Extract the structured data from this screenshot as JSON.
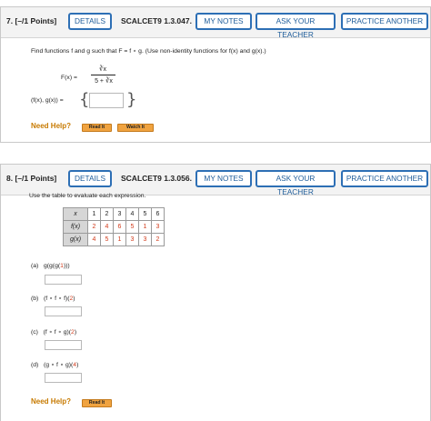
{
  "q7": {
    "number": "7.  [–/1 Points]",
    "details": "DETAILS",
    "code": "SCALCET9 1.3.047.",
    "my_notes": "MY NOTES",
    "ask_teacher": "ASK YOUR TEACHER",
    "practice": "PRACTICE ANOTHER",
    "prompt": "Find functions f and g such that F = f ∘ g. (Use non-identity functions for f(x) and g(x).)",
    "fx_label": "F(x)  =",
    "numerator": "∛x",
    "denominator": "5 + ∛x",
    "pair_label": "(f(x), g(x))  =",
    "open_brace": "{",
    "close_brace": "}",
    "answer_value": "",
    "need_help": "Need Help?",
    "read_it": "Read It",
    "watch_it": "Watch It"
  },
  "q8": {
    "number": "8.  [–/1 Points]",
    "details": "DETAILS",
    "code": "SCALCET9 1.3.056.",
    "my_notes": "MY NOTES",
    "ask_teacher": "ASK YOUR TEACHER",
    "practice": "PRACTICE ANOTHER",
    "prompt": "Use the table to evaluate each expression.",
    "table": {
      "x_label": "x",
      "f_label": "f(x)",
      "g_label": "g(x)",
      "x": [
        "1",
        "2",
        "3",
        "4",
        "5",
        "6"
      ],
      "f": [
        "2",
        "4",
        "6",
        "5",
        "1",
        "3"
      ],
      "g": [
        "4",
        "5",
        "1",
        "3",
        "3",
        "2"
      ]
    },
    "parts": [
      {
        "label": "(a)",
        "pre": "g(g(g(",
        "arg": "1",
        "post": ")))",
        "value": ""
      },
      {
        "label": "(b)",
        "pre": "(f ∘ f ∘ f)(",
        "arg": "2",
        "post": ")",
        "value": ""
      },
      {
        "label": "(c)",
        "pre": "(f ∘ f ∘ g)(",
        "arg": "2",
        "post": ")",
        "value": ""
      },
      {
        "label": "(d)",
        "pre": "(g ∘ f ∘ g)(",
        "arg": "4",
        "post": ")",
        "value": ""
      }
    ],
    "need_help": "Need Help?",
    "read_it": "Read It"
  },
  "colors": {
    "header_bg": "#f3f3f3",
    "button_border": "#2d6fb5",
    "need_help": "#c77a00",
    "help_button": "#f0a340",
    "table_value": "#d13a1a",
    "table_header": "#d6d6d6"
  }
}
